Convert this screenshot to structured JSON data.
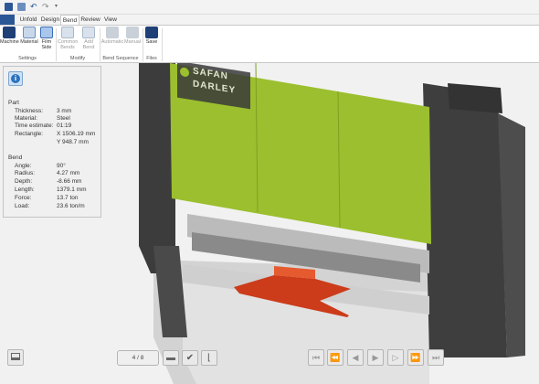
{
  "quick_access": {
    "file_label": ""
  },
  "tabs": [
    {
      "label": "Unfold"
    },
    {
      "label": "Design"
    },
    {
      "label": "Bend"
    },
    {
      "label": "Review"
    },
    {
      "label": "View"
    }
  ],
  "ribbon": {
    "settings": {
      "machine": "Machine",
      "material": "Material",
      "film_side": "Film Side",
      "group": "Settings"
    },
    "modify": {
      "common_bends": "Common Bends",
      "add_bend": "Add Bend",
      "group": "Modify"
    },
    "bend_sequence": {
      "automatic": "Automatic",
      "manual": "Manual",
      "group": "Bend Sequence"
    },
    "files": {
      "save": "Save",
      "group": "Files"
    }
  },
  "brand": {
    "line1": "SAFAN",
    "line2": "DARLEY"
  },
  "info_panel": {
    "part_title": "Part",
    "part_rows": [
      {
        "label": "Thickness:",
        "value": "3 mm"
      },
      {
        "label": "Material:",
        "value": "Steel"
      },
      {
        "label": "Time estimate:",
        "value": "01:19"
      },
      {
        "label": "Rectangle:",
        "value": "X 1506.19 mm"
      },
      {
        "label": "",
        "value": "Y 948.7 mm"
      }
    ],
    "bend_title": "Bend",
    "bend_rows": [
      {
        "label": "Angle:",
        "value": "90°"
      },
      {
        "label": "Radius:",
        "value": "4.27 mm"
      },
      {
        "label": "Depth:",
        "value": "-8.66 mm"
      },
      {
        "label": "Length:",
        "value": "1379.1 mm"
      },
      {
        "label": "Force:",
        "value": "13.7 ton"
      },
      {
        "label": "Load:",
        "value": "23.6 ton/m"
      }
    ]
  },
  "pager": {
    "text": "4 / 8"
  },
  "colors": {
    "machine_green": "#9bbf2e",
    "machine_dark": "#3e3e3e",
    "part_red": "#cc3c1a",
    "accent_blue": "#2b5797"
  }
}
